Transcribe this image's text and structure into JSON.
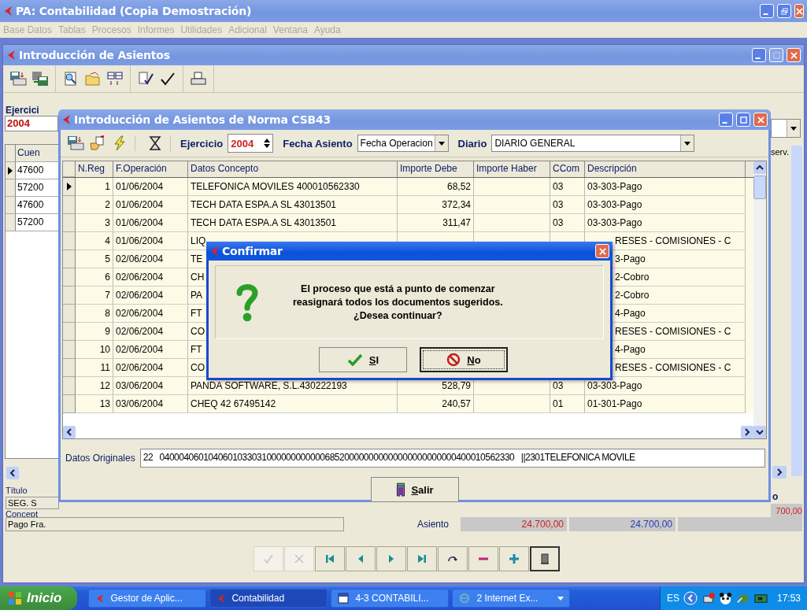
{
  "app": {
    "title": "PA: Contabilidad (Copia Demostración)",
    "menu": [
      "Base Datos",
      "Tablas",
      "Procesos",
      "Informes",
      "Utilidades",
      "Adicional",
      "Ventana",
      "Ayuda"
    ]
  },
  "child_window": {
    "title": "Introducción de Asientos",
    "ejercicio_label": "Ejercici",
    "ejercicio_value": "2004",
    "grid_header": "Cuen",
    "grid_rows": [
      {
        "value": "47600",
        "selected": true
      },
      {
        "value": "57200",
        "selected": false
      },
      {
        "value": "47600",
        "selected": false
      },
      {
        "value": "57200",
        "selected": false
      }
    ],
    "right_header": "serv.",
    "right_label": "o",
    "right_value": "700,00",
    "titulo_label": "Título",
    "titulo_value": "SEG. S",
    "concepto_label": "Concept",
    "concepto_value": "Pago Fra.",
    "total_label": "Asiento",
    "total_debe": "24.700,00",
    "total_haber": "24.700,00",
    "nav_buttons": [
      {
        "kind": "accept",
        "disabled": true
      },
      {
        "kind": "cancel",
        "disabled": true
      },
      {
        "kind": "first",
        "disabled": false
      },
      {
        "kind": "prior",
        "disabled": false
      },
      {
        "kind": "next",
        "disabled": false
      },
      {
        "kind": "last",
        "disabled": false
      },
      {
        "kind": "refresh",
        "disabled": false
      },
      {
        "kind": "delete",
        "disabled": false
      },
      {
        "kind": "insert",
        "disabled": false
      },
      {
        "kind": "exit",
        "disabled": false
      }
    ]
  },
  "import_window": {
    "title": "Introducción de Asientos de Norma CSB43",
    "ejercicio_label": "Ejercicio",
    "ejercicio_value": "2004",
    "fecha_label": "Fecha Asiento",
    "fecha_value": "Fecha Operacion",
    "diario_label": "Diario",
    "diario_value": "DIARIO GENERAL",
    "columns": [
      "N.Reg",
      "F.Operación",
      "Datos Concepto",
      "Importe Debe",
      "Importe Haber",
      "CCom",
      "Descripción"
    ],
    "rows": [
      {
        "nreg": "1",
        "fecha": "01/06/2004",
        "concepto": "TELEFONICA MOVILES  400010562330",
        "debe": "68,52",
        "ccom": "03",
        "descripcion": "03-303-Pago",
        "selected": true,
        "covered": false
      },
      {
        "nreg": "2",
        "fecha": "01/06/2004",
        "concepto": "TECH DATA ESPA.A SL 43013501",
        "debe": "372,34",
        "ccom": "03",
        "descripcion": "03-303-Pago",
        "selected": false,
        "covered": false
      },
      {
        "nreg": "3",
        "fecha": "01/06/2004",
        "concepto": "TECH DATA ESPA.A SL 43013501",
        "debe": "311,47",
        "ccom": "03",
        "descripcion": "03-303-Pago",
        "selected": false,
        "covered": false
      },
      {
        "nreg": "4",
        "fecha": "01/06/2004",
        "concepto": "LIQ",
        "descripcion": "RESES - COMISIONES - C",
        "selected": false,
        "covered": true
      },
      {
        "nreg": "5",
        "fecha": "02/06/2004",
        "concepto": "TE",
        "descripcion": "3-Pago",
        "selected": false,
        "covered": true
      },
      {
        "nreg": "6",
        "fecha": "02/06/2004",
        "concepto": "CH",
        "descripcion": "2-Cobro",
        "selected": false,
        "covered": true
      },
      {
        "nreg": "7",
        "fecha": "02/06/2004",
        "concepto": "PA",
        "descripcion": "2-Cobro",
        "selected": false,
        "covered": true
      },
      {
        "nreg": "8",
        "fecha": "02/06/2004",
        "concepto": "FT",
        "descripcion": "4-Pago",
        "selected": false,
        "covered": true
      },
      {
        "nreg": "9",
        "fecha": "02/06/2004",
        "concepto": "CO",
        "descripcion": "RESES - COMISIONES - C",
        "selected": false,
        "covered": true
      },
      {
        "nreg": "10",
        "fecha": "02/06/2004",
        "concepto": "FT",
        "descripcion": "4-Pago",
        "selected": false,
        "covered": true
      },
      {
        "nreg": "11",
        "fecha": "02/06/2004",
        "concepto": "CO",
        "descripcion": "RESES - COMISIONES - C",
        "selected": false,
        "covered": true
      },
      {
        "nreg": "12",
        "fecha": "03/06/2004",
        "concepto": "PANDA SOFTWARE, S.L.430222193",
        "debe": "528,79",
        "ccom": "03",
        "descripcion": "03-303-Pago",
        "selected": false,
        "covered": false
      },
      {
        "nreg": "13",
        "fecha": "03/06/2004",
        "concepto": "CHEQ 42 67495142",
        "debe": "240,57",
        "ccom": "01",
        "descripcion": "01-301-Pago",
        "selected": false,
        "covered": false
      }
    ],
    "datos_label": "Datos Originales",
    "datos_value": "22   0400040601040601033031000000000000685200000000000000000000000400010562330   ||2301TELEFONICA MOVILE",
    "exit_button": "Salir"
  },
  "dialog": {
    "title": "Confirmar",
    "message_lines": [
      "El proceso que está a punto de comenzar",
      "reasignará todos los documentos sugeridos.",
      "¿Desea continuar?"
    ],
    "buttons": [
      {
        "label": "SI",
        "kind": "yes",
        "focused": false
      },
      {
        "label": "No",
        "kind": "no",
        "focused": true
      }
    ]
  },
  "taskbar": {
    "start": "Inicio",
    "tasks": [
      {
        "label": "Gestor de Aplic...",
        "kind": "app",
        "selected": false
      },
      {
        "label": "Contabilidad",
        "kind": "app",
        "selected": true
      },
      {
        "label": "4-3 CONTABILI...",
        "kind": "word",
        "selected": false
      },
      {
        "label": "2 Internet Ex...",
        "kind": "browser",
        "selected": false
      }
    ],
    "language": "ES",
    "clock": "17:53"
  }
}
